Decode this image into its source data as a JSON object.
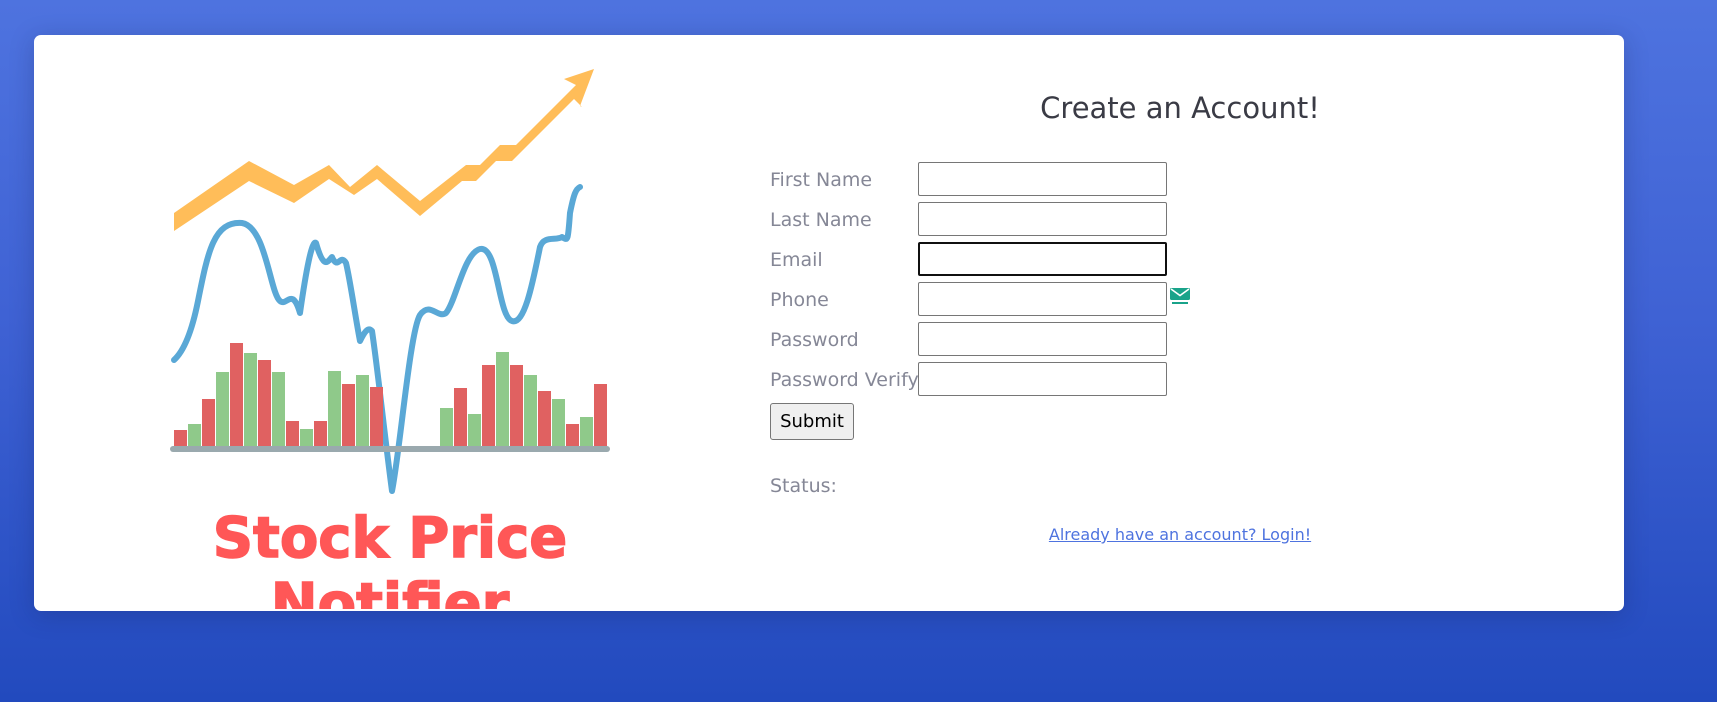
{
  "logo": {
    "line1": "Stock Price",
    "line2": "Notifier",
    "colors": {
      "arrow": "#ffbd59",
      "line": "#5aa8d6",
      "bar_red": "#e06161",
      "bar_green": "#8fc98a",
      "axis": "#9aa9ae",
      "title": "#ff5757"
    }
  },
  "form": {
    "heading": "Create an Account!",
    "fields": [
      {
        "label": "First Name",
        "value": ""
      },
      {
        "label": "Last Name",
        "value": ""
      },
      {
        "label": "Email",
        "value": "",
        "icon": "mail-icon"
      },
      {
        "label": "Phone",
        "value": ""
      },
      {
        "label": "Password",
        "value": ""
      },
      {
        "label": "Password Verify",
        "value": ""
      }
    ],
    "submit_label": "Submit",
    "status_label": "Status:",
    "login_link": "Already have an account? Login!"
  },
  "colors": {
    "background_top": "#4e73df",
    "background_bottom": "#224abe",
    "heading": "#3a3b45",
    "label": "#858796",
    "link": "#4e73df"
  }
}
